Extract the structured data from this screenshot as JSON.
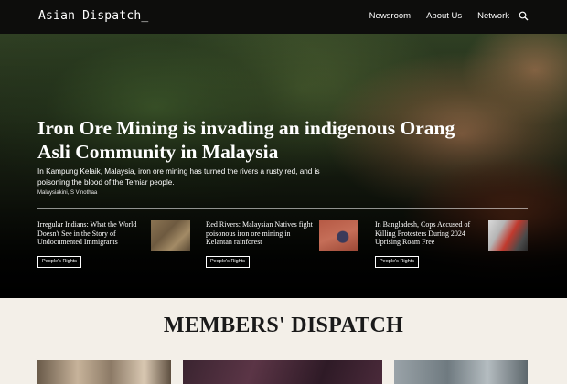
{
  "header": {
    "logo": "Asian Dispatch_",
    "nav": [
      {
        "label": "Newsroom"
      },
      {
        "label": "About Us"
      },
      {
        "label": "Network"
      }
    ],
    "search_icon": "search-icon"
  },
  "hero": {
    "title": "Iron Ore Mining is invading an indigenous Orang Asli Community in Malaysia",
    "description": "In Kampung Kelaik, Malaysia, iron ore mining has turned the rivers a rusty red, and is poisoning the blood of the Temiar people.",
    "byline": "Malaysiakini, S Vinothaa"
  },
  "stories": [
    {
      "title": "Irregular Indians: What the World Doesn't See in the Story of Undocumented Immigrants",
      "tag": "People's Rights"
    },
    {
      "title": "Red Rivers: Malaysian Natives fight poisonous iron ore mining in Kelantan rainforest",
      "tag": "People's Rights"
    },
    {
      "title": "In Bangladesh, Cops Accused of Killing Protesters During 2024 Uprising Roam Free",
      "tag": "People's Rights"
    }
  ],
  "members": {
    "heading": "MEMBERS' DISPATCH"
  }
}
